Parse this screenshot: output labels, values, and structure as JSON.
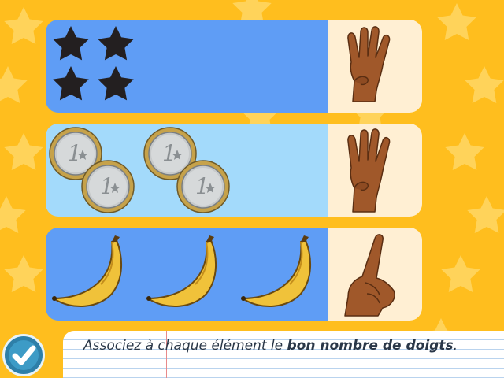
{
  "game": {
    "instruction_prefix": "Associez à chaque élément le ",
    "instruction_bold": "bon nombre de doigts",
    "instruction_suffix": ".",
    "rows": [
      {
        "objects": "stars",
        "count": 4,
        "fingers_shown": 4,
        "panel_color": "#5F9DF5"
      },
      {
        "objects": "euro coins",
        "count": 4,
        "fingers_shown": 4,
        "panel_color": "#A3DAFB"
      },
      {
        "objects": "bananas",
        "count": 3,
        "fingers_shown": 1,
        "panel_color": "#5F9DF5"
      }
    ],
    "coin_label": "1"
  },
  "icons": {
    "validate": "checkmark-icon",
    "star": "star-icon",
    "coin": "euro-coin-icon",
    "banana": "banana-icon",
    "hand": "hand-icon"
  },
  "colors": {
    "background": "#FFBE1E",
    "hand_slot": "#FFEFD3",
    "validate_button": "#2E7FA8"
  }
}
